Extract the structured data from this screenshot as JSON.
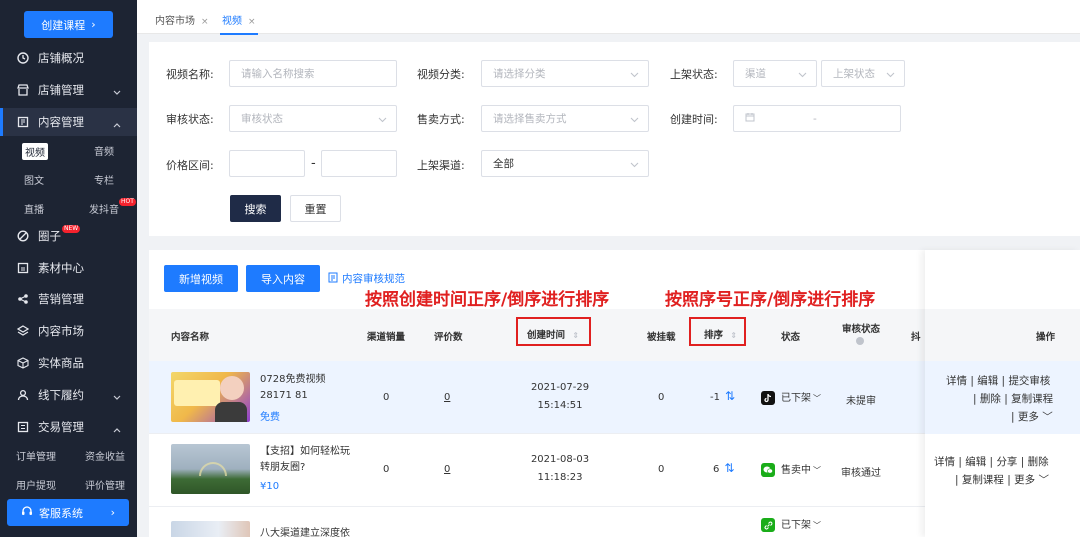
{
  "sidebar": {
    "create_label": "创建课程",
    "items": [
      {
        "label": "店铺概况",
        "icon": "clock-icon"
      },
      {
        "label": "店铺管理",
        "icon": "store-icon"
      },
      {
        "label": "内容管理",
        "icon": "content-icon"
      },
      {
        "label": "圈子",
        "icon": "circle-icon",
        "tag": "NEW"
      },
      {
        "label": "素材中心",
        "icon": "material-icon"
      },
      {
        "label": "营销管理",
        "icon": "share-icon"
      },
      {
        "label": "内容市场",
        "icon": "layers-icon"
      },
      {
        "label": "实体商品",
        "icon": "box-icon"
      },
      {
        "label": "线下履约",
        "icon": "user-icon"
      },
      {
        "label": "交易管理",
        "icon": "trade-icon"
      }
    ],
    "content_sub": [
      "视频",
      "音频",
      "图文",
      "专栏",
      "直播",
      "发抖音"
    ],
    "content_sub_tag": "HOT",
    "trade_sub": [
      "订单管理",
      "资金收益",
      "用户提现",
      "评价管理"
    ],
    "service_label": "客服系统"
  },
  "tabs": [
    {
      "label": "内容市场"
    },
    {
      "label": "视频"
    }
  ],
  "filters": {
    "video_name_label": "视频名称:",
    "video_name_placeholder": "请输入名称搜索",
    "category_label": "视频分类:",
    "category_placeholder": "请选择分类",
    "shelf_status_label": "上架状态:",
    "channel_placeholder": "渠道",
    "shelf_status_placeholder": "上架状态",
    "review_label": "审核状态:",
    "review_placeholder": "审核状态",
    "sale_label": "售卖方式:",
    "sale_placeholder": "请选择售卖方式",
    "created_label": "创建时间:",
    "date_sep": "-",
    "price_label": "价格区间:",
    "price_sep": "-",
    "channel_label": "上架渠道:",
    "channel_value": "全部",
    "search_label": "搜索",
    "reset_label": "重置"
  },
  "actions": {
    "add_video": "新增视频",
    "import": "导入内容",
    "rules_link": "内容审核规范"
  },
  "annotations": {
    "time_sort": "按照创建时间正序/倒序进行排序",
    "seq_sort": "按照序号正序/倒序进行排序"
  },
  "table": {
    "headers": {
      "name": "内容名称",
      "channel_sales": "渠道销量",
      "reviews": "评价数",
      "created": "创建时间",
      "hang": "被挂载",
      "order": "排序",
      "status": "状态",
      "audit": "审核状态",
      "douyin": "抖",
      "ops": "操作"
    },
    "rows": [
      {
        "title": "0728免费视频28171 81",
        "price": "免费",
        "sales": "0",
        "reviews": "0",
        "date": "2021-07-29",
        "time": "15:14:51",
        "hang": "0",
        "order": "-1",
        "status": "已下架",
        "audit": "未提审",
        "ops_line1": [
          "详情",
          "编辑",
          "提交审核"
        ],
        "ops_line2": [
          "删除",
          "复制课程"
        ],
        "more": "更多"
      },
      {
        "title": "【支招】如何轻松玩转朋友圈?",
        "price": "¥10",
        "sales": "0",
        "reviews": "0",
        "date": "2021-08-03",
        "time": "11:18:23",
        "hang": "0",
        "order": "6",
        "status": "售卖中",
        "audit": "审核通过",
        "ops_line1": [
          "详情",
          "编辑",
          "分享",
          "删除"
        ],
        "ops_line2": [
          "复制课程"
        ],
        "more": "更多"
      },
      {
        "title": "八大渠道建立深度依",
        "status": "已下架"
      }
    ]
  },
  "colors": {
    "sidebar_bg": "#1d2433",
    "accent": "#1e7bff",
    "annotation": "#e02020"
  }
}
